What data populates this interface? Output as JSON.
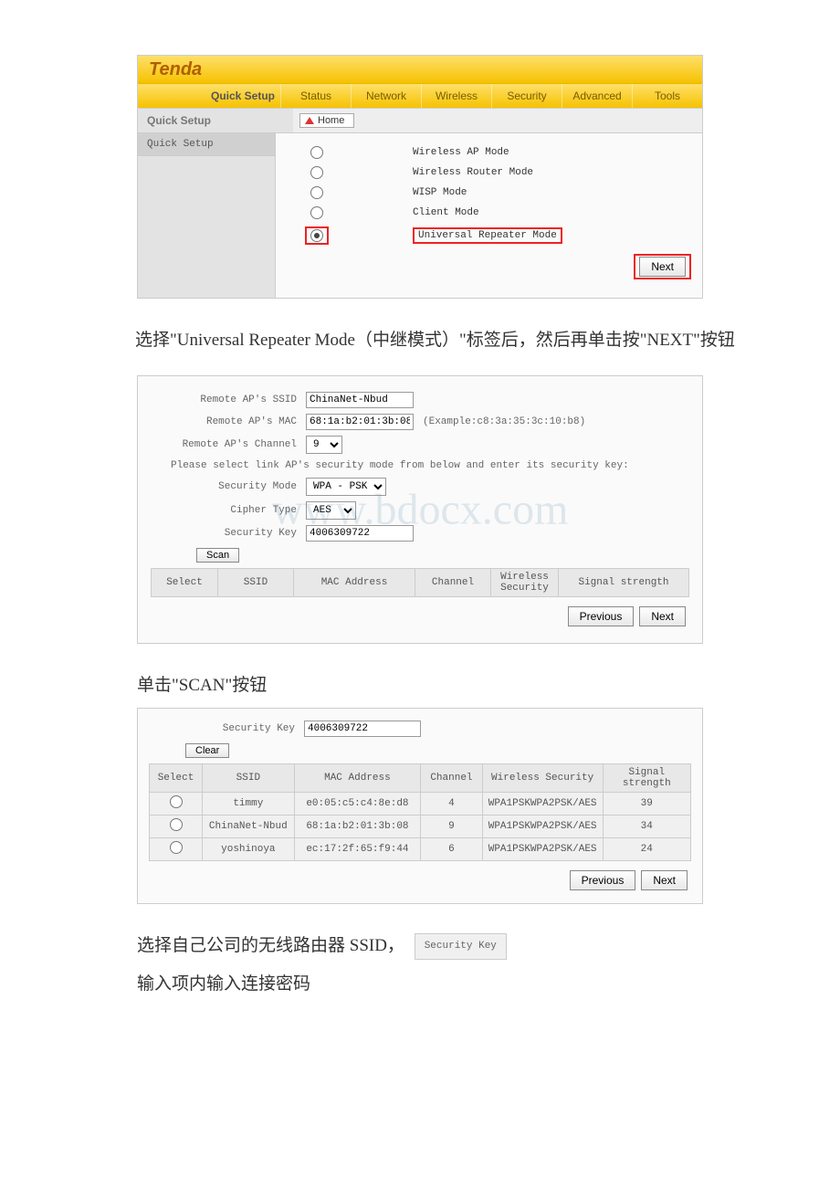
{
  "section1": {
    "brand": "Tenda",
    "quick_label": "Quick Setup",
    "tabs": [
      "Status",
      "Network",
      "Wireless",
      "Security",
      "Advanced",
      "Tools"
    ],
    "side_title": "Quick Setup",
    "home_label": "Home",
    "sidebar_item": "Quick Setup",
    "modes": [
      "Wireless AP Mode",
      "Wireless Router Mode",
      "WISP Mode",
      "Client Mode",
      "Universal Repeater Mode"
    ],
    "next_label": "Next"
  },
  "text1": "选择\"Universal Repeater Mode（中继模式）\"标签后，然后再单击按\"NEXT\"按钮",
  "section2": {
    "labels": {
      "ssid": "Remote AP's SSID",
      "mac": "Remote AP's MAC",
      "channel": "Remote AP's Channel",
      "note": "Please select link AP's security mode from below and enter its security key:",
      "secmode": "Security Mode",
      "cipher": "Cipher Type",
      "seckey": "Security Key",
      "scan": "Scan",
      "example": "(Example:c8:3a:35:3c:10:b8)"
    },
    "values": {
      "ssid": "ChinaNet-Nbud",
      "mac": "68:1a:b2:01:3b:08",
      "channel": "9",
      "secmode": "WPA - PSK",
      "cipher": "AES",
      "seckey": "4006309722"
    },
    "table_headers": [
      "Select",
      "SSID",
      "MAC Address",
      "Channel",
      "Wireless Security",
      "Signal strength"
    ],
    "prev_label": "Previous",
    "next_label": "Next",
    "watermark": "www.bdocx.com"
  },
  "text2": "单击\"SCAN\"按钮",
  "section3": {
    "seckey_label": "Security Key",
    "seckey_value": "4006309722",
    "clear_label": "Clear",
    "table_headers": [
      "Select",
      "SSID",
      "MAC Address",
      "Channel",
      "Wireless Security",
      "Signal strength"
    ],
    "rows": [
      {
        "ssid": "timmy",
        "mac": "e0:05:c5:c4:8e:d8",
        "channel": "4",
        "sec": "WPA1PSKWPA2PSK/AES",
        "signal": "39"
      },
      {
        "ssid": "ChinaNet-Nbud",
        "mac": "68:1a:b2:01:3b:08",
        "channel": "9",
        "sec": "WPA1PSKWPA2PSK/AES",
        "signal": "34"
      },
      {
        "ssid": "yoshinoya",
        "mac": "ec:17:2f:65:f9:44",
        "channel": "6",
        "sec": "WPA1PSKWPA2PSK/AES",
        "signal": "24"
      }
    ],
    "prev_label": "Previous",
    "next_label": "Next"
  },
  "text3_prefix": "选择自己公司的无线路由器 SSID，",
  "text3_keybox": "Security Key",
  "text4": "输入项内输入连接密码"
}
